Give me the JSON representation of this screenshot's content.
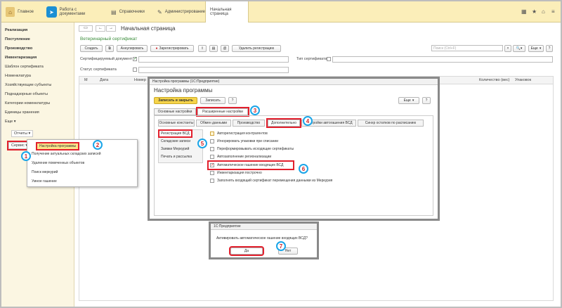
{
  "topbar": {
    "home_label": "Главное",
    "tabs": [
      "Работа с документами",
      "Справочники",
      "Администрирование",
      "Начальная страница"
    ]
  },
  "sidebar": {
    "items": [
      "Реализация",
      "Поступление",
      "Производство",
      "Инвентаризация",
      "Шаблон сертификата",
      "Номенклатура",
      "Хозяйствующие субъекты",
      "Поднадзорные объекты",
      "Категории номенклатуры",
      "Единицы хранения",
      "Еще",
      "Отчеты",
      "Сервис"
    ]
  },
  "page": {
    "title": "Начальная страница",
    "subtitle": "Ветеринарный сертификат",
    "toolbar": [
      "Создать",
      "Аннулировать",
      "Зарегистрировать",
      "Удалить регистрацию"
    ],
    "search_placeholder": "Поиск (Ctrl+F)",
    "more": "Еще",
    "filter1": "Сертифицируемый документ",
    "filter2": "Статус сертификата",
    "filter3": "Тип сертификата",
    "columns": [
      "М",
      "Дата",
      "Номер"
    ],
    "columns_right": [
      "Количество (вес)",
      "Упаковок"
    ]
  },
  "service_menu": {
    "items": [
      "Настройка программы",
      "Получение актуальных складских записей",
      "Удаление помеченных объектов",
      "Поиск меркурий",
      "Умное гашение"
    ]
  },
  "settings": {
    "window_title": "Настройка программы (1С:Предприятие)",
    "title": "Настройка программы",
    "save_close": "Записать и закрыть",
    "save": "Записать",
    "help": "?",
    "more": "Еще",
    "tabs": [
      "Основные настройки",
      "Расширенные настройки"
    ],
    "subtabs": [
      "Основные константы",
      "Обмен данными",
      "Производство",
      "Дополнительно",
      "Настройки автогашения ВСД",
      "Синхр остатков по расписанию"
    ],
    "side_items": [
      "Регистрация ВСД",
      "Складские записи",
      "Заявки Меркурий",
      "Печать и рассылка"
    ],
    "options": [
      "Авторегистрация контрагентов",
      "Игнорировать упаковки при списании",
      "Переформировывать исходящие сертификаты",
      "Автозаполнение регионализации",
      "Автоматическое гашение входящих ВСД",
      "Инвентаризация построчно",
      "Заполнять входящий сертификат перемещения данными из Меркурия"
    ]
  },
  "confirm": {
    "window_title": "1С:Предприятие",
    "question": "Активировать автоматическое гашение входящих ВСД?",
    "yes": "Да",
    "no": "Нет"
  },
  "markers": [
    "1",
    "2",
    "3",
    "4",
    "5",
    "6",
    "7"
  ]
}
